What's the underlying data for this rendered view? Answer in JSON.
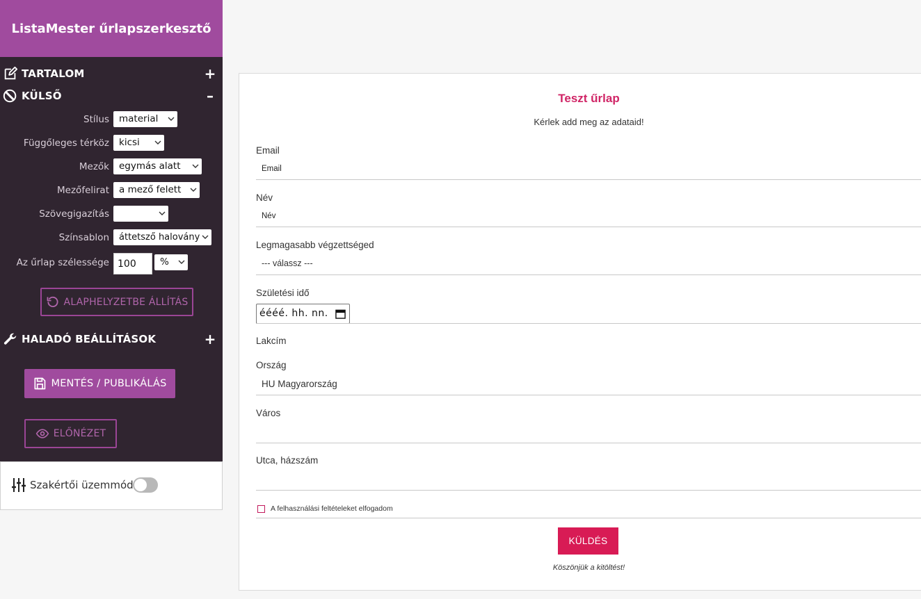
{
  "app": {
    "title": "ListaMester űrlapszerkesztő"
  },
  "sidebar": {
    "content_section": {
      "label": "TARTALOM",
      "toggle": "+"
    },
    "appearance_section": {
      "label": "KÜLSŐ",
      "toggle": "–"
    },
    "options": [
      {
        "label": "Stílus",
        "value": "material"
      },
      {
        "label": "Függőleges térköz",
        "value": "kicsi"
      },
      {
        "label": "Mezők",
        "value": "egymás alatt"
      },
      {
        "label": "Mezőfelirat",
        "value": "a mező felett"
      },
      {
        "label": "Szövegigazítás",
        "value": ""
      },
      {
        "label": "Színsablon",
        "value": "áttetsző halovány"
      }
    ],
    "width": {
      "label": "Az űrlap szélessége",
      "value": "100",
      "unit": "%"
    },
    "reset_button": "ALAPHELYZETBE ÁLLÍTÁS",
    "advanced_section": {
      "label": "HALADÓ BEÁLLÍTÁSOK",
      "toggle": "+"
    },
    "save_button": "MENTÉS / PUBLIKÁLÁS",
    "preview_button": "ELŐNÉZET",
    "expert_mode": {
      "label": "Szakértői üzemmód",
      "enabled": false
    }
  },
  "form": {
    "title": "Teszt űrlap",
    "subtitle": "Kérlek add meg az adataid!",
    "fields": {
      "email": {
        "label": "Email",
        "placeholder": "Email"
      },
      "name": {
        "label": "Név",
        "placeholder": "Név"
      },
      "education": {
        "label": "Legmagasabb végzettséged",
        "value": "--- válassz ---"
      },
      "birthdate": {
        "label": "Születési idő",
        "value": "éééé. hh. nn."
      },
      "address_heading": "Lakcím",
      "country": {
        "label": "Ország",
        "value": "HU Magyarország"
      },
      "city": {
        "label": "Város"
      },
      "street": {
        "label": "Utca, házszám"
      }
    },
    "terms": {
      "label": "A felhasználási feltételeket elfogadom",
      "checked": false
    },
    "submit_label": "KÜLDÉS",
    "thanks": "Köszönjük a kitöltést!"
  },
  "colors": {
    "brand": "#a04b9e",
    "sidebar_bg": "#302530",
    "form_accent": "#d81b55",
    "form_title": "#d02566"
  },
  "icons": {
    "content": "edit-icon",
    "appearance": "palette-icon",
    "advanced": "wrench-icon",
    "reset": "reset-icon",
    "save": "floppy-disk-icon",
    "preview": "eye-icon",
    "expert": "sliders-icon",
    "date": "calendar-icon"
  }
}
